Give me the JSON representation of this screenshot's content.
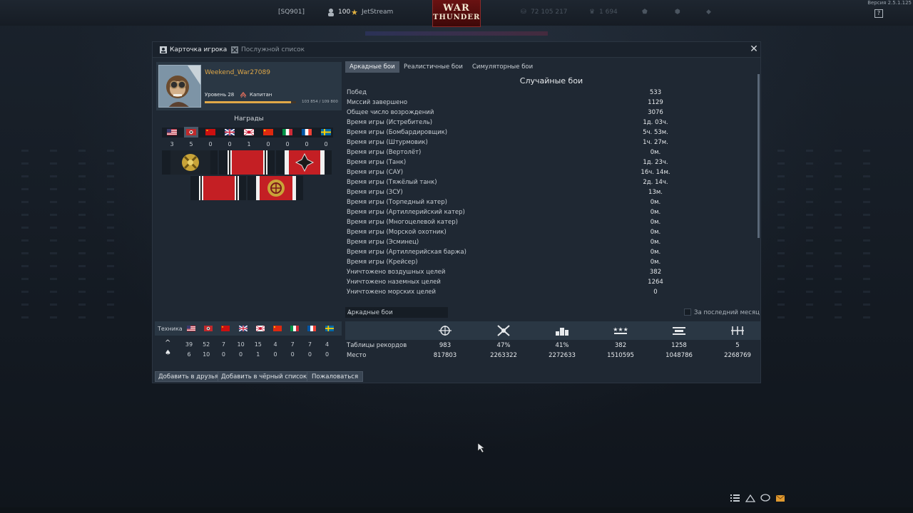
{
  "topbar": {
    "squad": "[SQ901]",
    "level": "100",
    "nickname": "JetStream",
    "lions": "72 105 217",
    "gold": "1 694",
    "version": "Версия 2.5.1.125",
    "help": "?"
  },
  "logo": {
    "line1": "WAR",
    "line2": "THUNDER"
  },
  "window": {
    "tabs": [
      {
        "label": "Карточка игрока",
        "icon": "player-card-icon"
      },
      {
        "label": "Послужной список",
        "icon": "service-record-icon"
      }
    ],
    "close": "✕"
  },
  "profile": {
    "name": "Weekend_War27089",
    "level": "Уровень 28",
    "rank": "Капитан",
    "xp": "103 854 / 109 800",
    "xp_progress": 0.946
  },
  "awards": {
    "title": "Награды",
    "nations": [
      {
        "nation": "usa",
        "count": "3"
      },
      {
        "nation": "germany",
        "count": "5"
      },
      {
        "nation": "ussr",
        "count": "0"
      },
      {
        "nation": "britain",
        "count": "0"
      },
      {
        "nation": "japan",
        "count": "1"
      },
      {
        "nation": "china",
        "count": "0"
      },
      {
        "nation": "italy",
        "count": "0"
      },
      {
        "nation": "france",
        "count": "0"
      },
      {
        "nation": "sweden",
        "count": "0"
      }
    ],
    "selected_nation": "germany",
    "medals": [
      "gold-cross-medal-icon",
      "red-ribbon-medal-icon",
      "iron-cross-medal-icon",
      "red-ribbon-medal-icon",
      "wheel-emblem-medal-icon"
    ]
  },
  "vehicles": {
    "label": "Техника",
    "nations": [
      "usa",
      "germany",
      "ussr",
      "britain",
      "japan",
      "china",
      "italy",
      "france",
      "sweden"
    ],
    "rows": [
      {
        "icon": "^",
        "icon_name": "researched-icon",
        "values": [
          "39",
          "52",
          "7",
          "10",
          "15",
          "4",
          "7",
          "7",
          "4"
        ]
      },
      {
        "icon": "♠",
        "icon_name": "elite-icon",
        "values": [
          "6",
          "10",
          "0",
          "0",
          "1",
          "0",
          "0",
          "0",
          "0"
        ]
      }
    ]
  },
  "mode_tabs": [
    "Аркадные бои",
    "Реалистичные бои",
    "Симуляторные бои"
  ],
  "active_mode_tab": 0,
  "stats": {
    "title": "Случайные бои",
    "rows": [
      {
        "label": "Побед",
        "value": "533"
      },
      {
        "label": "Миссий завершено",
        "value": "1129"
      },
      {
        "label": "Общее число возрождений",
        "value": "3076"
      },
      {
        "label": "Время игры (Истребитель)",
        "value": "1д. 03ч."
      },
      {
        "label": "Время игры (Бомбардировщик)",
        "value": "5ч. 53м."
      },
      {
        "label": "Время игры (Штурмовик)",
        "value": "1ч. 27м."
      },
      {
        "label": "Время игры (Вертолёт)",
        "value": "0м."
      },
      {
        "label": "Время игры (Танк)",
        "value": "1д. 23ч."
      },
      {
        "label": "Время игры (САУ)",
        "value": "16ч. 14м."
      },
      {
        "label": "Время игры (Тяжёлый танк)",
        "value": "2д. 14ч."
      },
      {
        "label": "Время игры (ЗСУ)",
        "value": "13м."
      },
      {
        "label": "Время игры (Торпедный катер)",
        "value": "0м."
      },
      {
        "label": "Время игры (Артиллерийский катер)",
        "value": "0м."
      },
      {
        "label": "Время игры (Многоцелевой катер)",
        "value": "0м."
      },
      {
        "label": "Время игры (Морской охотник)",
        "value": "0м."
      },
      {
        "label": "Время игры (Эсминец)",
        "value": "0м."
      },
      {
        "label": "Время игры (Артиллерийская баржа)",
        "value": "0м."
      },
      {
        "label": "Время игры (Крейсер)",
        "value": "0м."
      },
      {
        "label": "Уничтожено воздушных целей",
        "value": "382"
      },
      {
        "label": "Уничтожено наземных целей",
        "value": "1264"
      },
      {
        "label": "Уничтожено морских целей",
        "value": "0"
      }
    ]
  },
  "leaderboard": {
    "mode_select": "Аркадные бои",
    "last_month_label": "За последний месяц",
    "last_month_checked": false,
    "icons": [
      "victories-icon",
      "win-rate-icon",
      "top-place-icon",
      "air-kills-icon",
      "ground-kills-icon",
      "naval-kills-icon"
    ],
    "rows": [
      {
        "label": "Таблицы рекордов",
        "values": [
          "983",
          "47%",
          "41%",
          "382",
          "1258",
          "5"
        ]
      },
      {
        "label": "Место",
        "values": [
          "817803",
          "2263322",
          "2272633",
          "1510595",
          "1048786",
          "2268769"
        ]
      }
    ]
  },
  "actions": [
    "Добавить в друзья",
    "Добавить в чёрный список",
    "Пожаловаться"
  ],
  "bottom_icons": [
    "list-icon",
    "squad-icon",
    "chat-icon",
    "mail-icon"
  ],
  "colors": {
    "accent": "#e0a848",
    "panel": "#2a3744",
    "window": "#1f2833"
  }
}
